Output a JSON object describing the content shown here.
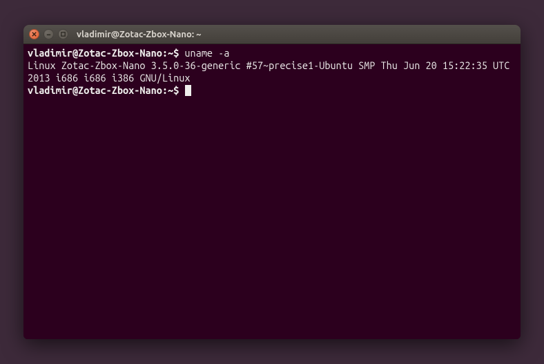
{
  "window": {
    "title": "vladimir@Zotac-Zbox-Nano: ~"
  },
  "terminal": {
    "prompt1": "vladimir@Zotac-Zbox-Nano:~$",
    "command1": "uname -a",
    "output1": "Linux Zotac-Zbox-Nano 3.5.0-36-generic #57~precise1-Ubuntu SMP Thu Jun 20 15:22:35 UTC 2013 i686 i686 i386 GNU/Linux",
    "prompt2": "vladimir@Zotac-Zbox-Nano:~$"
  }
}
